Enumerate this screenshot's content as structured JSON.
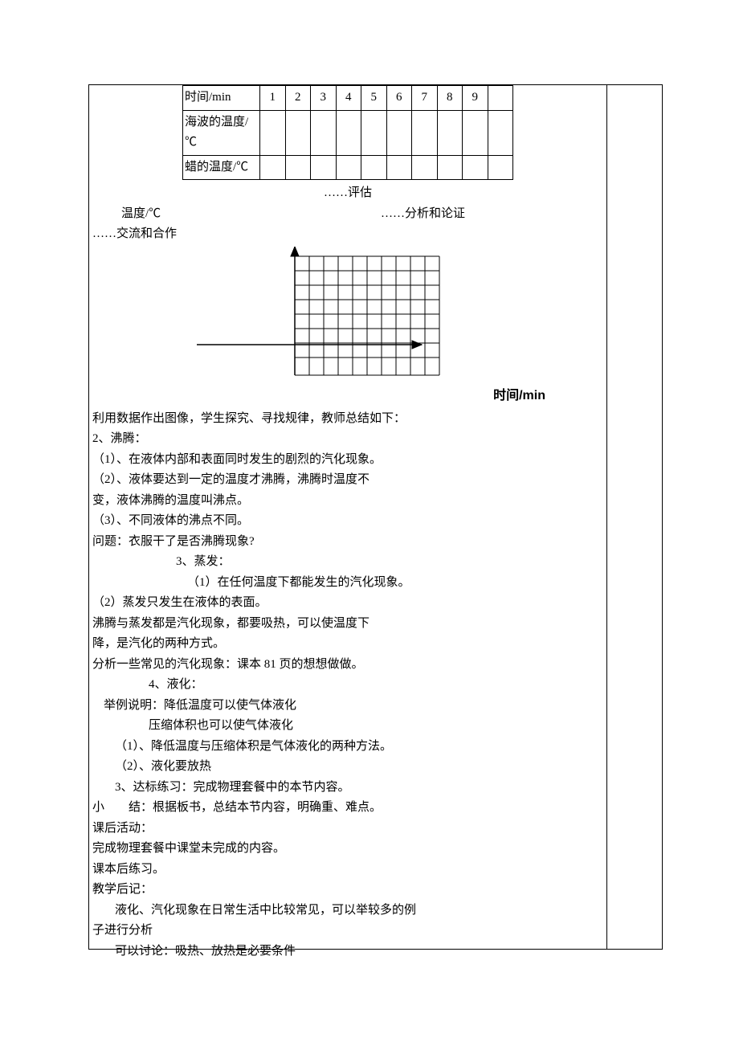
{
  "table": {
    "headers": [
      "时间/min",
      "海波的温度/℃",
      "蜡的温度/℃"
    ],
    "cols": [
      "1",
      "2",
      "3",
      "4",
      "5",
      "6",
      "7",
      "8",
      "9"
    ]
  },
  "mid": {
    "evaluate": "……评估",
    "analyze": "……分析和论证",
    "temp_label": "温度/℃",
    "coop": "……交流和合作",
    "time_axis": "时间/min"
  },
  "lines": {
    "l1": " 利用数据作出图像，学生探究、寻找规律，教师总结如下：",
    "l2": "2、沸腾：",
    "l3": "（1）、在液体内部和表面同时发生的剧烈的汽化现象。",
    "l4": "（2）、液体要达到一定的温度才沸腾，沸腾时温度不",
    "l5": "变，液体沸腾的温度叫沸点。",
    "l6": "（3）、不同液体的沸点不同。",
    "l7": "问题：衣服干了是否沸腾现象?",
    "l8": "3、蒸发：",
    "l9": "（1）在任何温度下都能发生的汽化现象。",
    "l10": "（2）蒸发只发生在液体的表面。",
    "l11": "沸腾与蒸发都是汽化现象，都要吸热，可以使温度下",
    "l12": "降，是汽化的两种方式。",
    "l13": "分析一些常见的汽化现象：课本 81 页的想想做做。",
    "l14": "4、液化：",
    "l15": "举例说明：降低温度可以使气体液化",
    "l16": "压缩体积也可以使气体液化",
    "l17": "（1）、降低温度与压缩体积是气体液化的两种方法。",
    "l18": "（2）、液化要放热",
    "l19": "3、达标练习：完成物理套餐中的本节内容。",
    "l20": "小　　结：根据板书，总结本节内容，明确重、难点。",
    "l21": "课后活动：",
    "l22": "完成物理套餐中课堂未完成的内容。",
    "l23": "课本后练习。",
    "l24": "教学后记：",
    "l25": "液化、汽化现象在日常生活中比较常见，可以举较多的例",
    "l26": "子进行分析",
    "l27": "可以讨论：吸热、放热是必要条件"
  }
}
